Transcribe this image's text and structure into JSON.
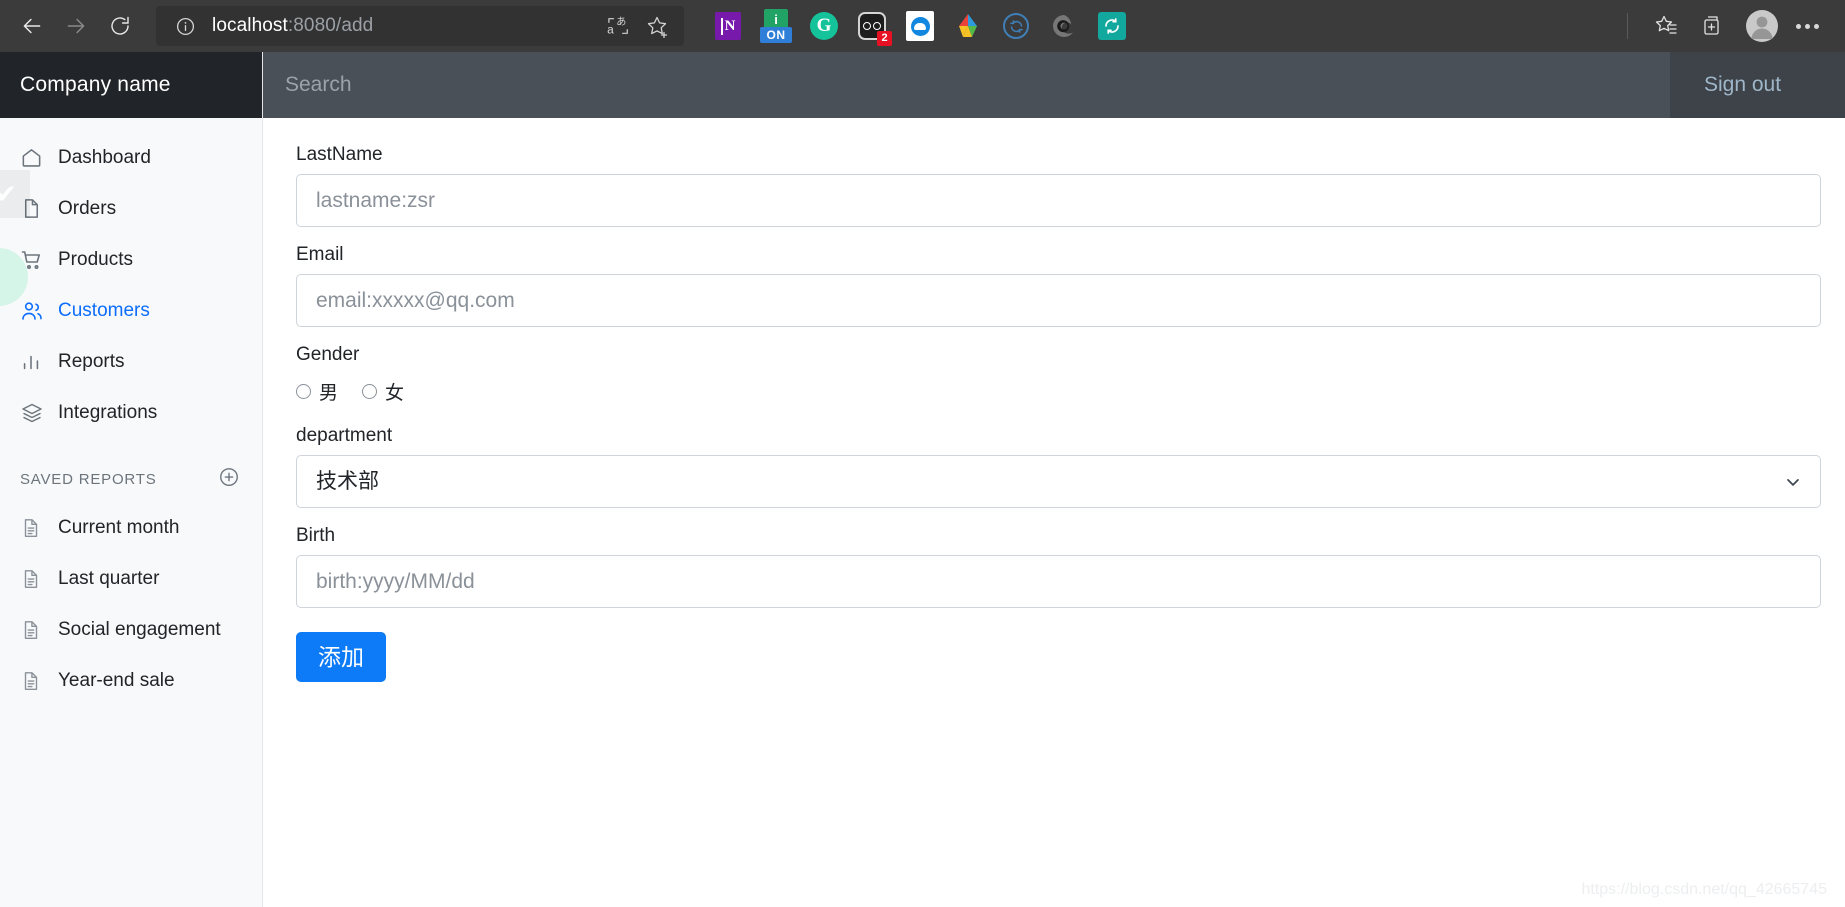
{
  "browser": {
    "back_label": "Back",
    "forward_label": "Forward",
    "refresh_label": "Refresh",
    "url_host": "localhost",
    "url_rest": ":8080/add",
    "site_info_label": "View site information",
    "translate_label": "Translate this page",
    "favorite_label": "Add this page to favorites",
    "extensions": [
      {
        "name": "onenote-extension-icon",
        "label": "OneNote",
        "badge": ""
      },
      {
        "name": "onenote-clipper-icon",
        "label": "ON",
        "badge": ""
      },
      {
        "name": "grammarly-extension-icon",
        "label": "G",
        "badge": ""
      },
      {
        "name": "dark-reader-extension-icon",
        "label": "Dark Reader",
        "badge": "2"
      },
      {
        "name": "onedrive-extension-icon",
        "label": "OneDrive",
        "badge": ""
      },
      {
        "name": "drive-extension-icon",
        "label": "Drive",
        "badge": ""
      },
      {
        "name": "sync-extension-icon",
        "label": "Sync",
        "badge": ""
      },
      {
        "name": "edge-extension-icon",
        "label": "Edge",
        "badge": ""
      },
      {
        "name": "refresh-extension-icon",
        "label": "Refresh",
        "badge": ""
      }
    ],
    "favorites_label": "Favorites",
    "collections_label": "Collections",
    "profile_label": "Profile",
    "settings_label": "Settings and more"
  },
  "sidebar": {
    "brand": "Company name",
    "items": [
      {
        "label": "Dashboard",
        "icon": "home-icon",
        "active": false
      },
      {
        "label": "Orders",
        "icon": "file-icon",
        "active": false
      },
      {
        "label": "Products",
        "icon": "cart-icon",
        "active": false
      },
      {
        "label": "Customers",
        "icon": "people-icon",
        "active": true
      },
      {
        "label": "Reports",
        "icon": "bar-chart-icon",
        "active": false
      },
      {
        "label": "Integrations",
        "icon": "layers-icon",
        "active": false
      }
    ],
    "section_title": "SAVED REPORTS",
    "add_report_label": "Add report",
    "reports": [
      {
        "label": "Current month",
        "icon": "document-icon"
      },
      {
        "label": "Last quarter",
        "icon": "document-icon"
      },
      {
        "label": "Social engagement",
        "icon": "document-icon"
      },
      {
        "label": "Year-end sale",
        "icon": "document-icon"
      }
    ]
  },
  "topbar": {
    "search_placeholder": "Search",
    "search_value": "",
    "signout_label": "Sign out"
  },
  "form": {
    "lastname": {
      "label": "LastName",
      "placeholder": "lastname:zsr",
      "value": ""
    },
    "email": {
      "label": "Email",
      "placeholder": "email:xxxxx@qq.com",
      "value": ""
    },
    "gender": {
      "label": "Gender",
      "options": [
        {
          "label": "男",
          "checked": false
        },
        {
          "label": "女",
          "checked": false
        }
      ]
    },
    "department": {
      "label": "department",
      "selected": "技术部",
      "options": [
        "技术部"
      ]
    },
    "birth": {
      "label": "Birth",
      "placeholder": "birth:yyyy/MM/dd",
      "value": ""
    },
    "submit_label": "添加"
  },
  "watermark": "https://blog.csdn.net/qq_42665745",
  "colors": {
    "accent": "#0d6efd",
    "button": "#0d7bf7",
    "sidebar_bg": "#f8f9fa",
    "brand_bg": "#212529",
    "topbar_bg": "#495057",
    "browser_bg": "#3b3b3b"
  }
}
